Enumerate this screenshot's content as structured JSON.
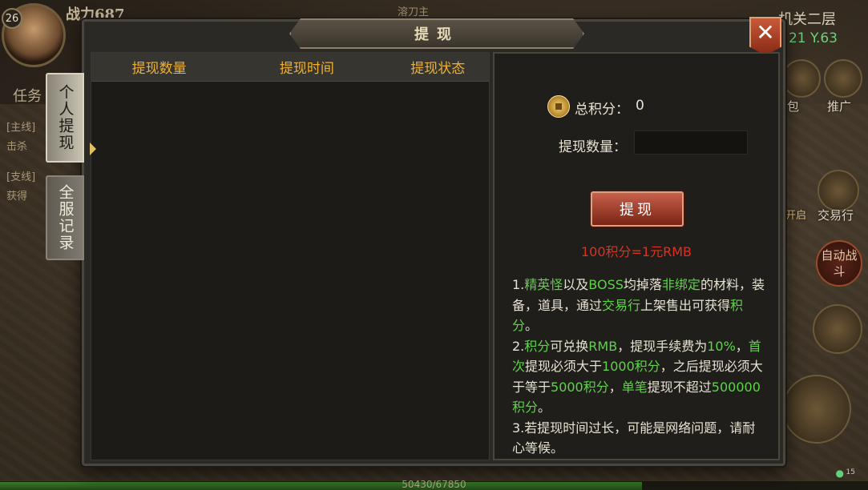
{
  "hud": {
    "level": "26",
    "power": "战力687",
    "map_top": "溶刀主",
    "map_name": "机关二层",
    "coords": "21 Y.63",
    "task_tab": "任务",
    "task_main": "[主线]",
    "task_main_detail": "击杀",
    "task_side": "[支线]",
    "task_side_detail": "获得",
    "bag_label": "包",
    "promo_label": "推广",
    "trade_label": "交易行",
    "open_label": "开启",
    "auto_fight": "自动战斗",
    "hp_text": "50430/67850",
    "wifi_num": "15"
  },
  "dialog": {
    "title": "提现",
    "close_icon": "close-icon",
    "tabs": [
      {
        "label": "个人提现",
        "active": true
      },
      {
        "label": "全服记录",
        "active": false
      }
    ],
    "list": {
      "columns": [
        "提现数量",
        "提现时间",
        "提现状态"
      ],
      "rows": []
    },
    "panel": {
      "total_label": "总积分：",
      "total_value": "0",
      "amount_label": "提现数量：",
      "amount_value": "",
      "withdraw_button": "提现",
      "rate": "100积分=1元RMB",
      "rules": [
        {
          "t": "1.",
          "c": ""
        },
        {
          "t": "精英怪",
          "c": "g"
        },
        {
          "t": "以及",
          "c": ""
        },
        {
          "t": "BOSS",
          "c": "g"
        },
        {
          "t": "均掉落",
          "c": ""
        },
        {
          "t": "非绑定",
          "c": "g"
        },
        {
          "t": "的材料，装备，道具，通过",
          "c": ""
        },
        {
          "t": "交易行",
          "c": "g"
        },
        {
          "t": "上架售出可获得",
          "c": ""
        },
        {
          "t": "积分",
          "c": "g"
        },
        {
          "t": "。",
          "c": ""
        },
        {
          "t": "\n2.",
          "c": ""
        },
        {
          "t": "积分",
          "c": "g"
        },
        {
          "t": "可兑换",
          "c": ""
        },
        {
          "t": "RMB",
          "c": "g"
        },
        {
          "t": "，提现手续费为",
          "c": ""
        },
        {
          "t": "10%",
          "c": "g"
        },
        {
          "t": "，",
          "c": ""
        },
        {
          "t": "首次",
          "c": "g"
        },
        {
          "t": "提现必须大于",
          "c": ""
        },
        {
          "t": "1000积分",
          "c": "g"
        },
        {
          "t": "，之后提现必须大于等于",
          "c": ""
        },
        {
          "t": "5000积分",
          "c": "g"
        },
        {
          "t": "，",
          "c": ""
        },
        {
          "t": "单笔",
          "c": "g"
        },
        {
          "t": "提现不超过",
          "c": ""
        },
        {
          "t": "500000积分",
          "c": "g"
        },
        {
          "t": "。",
          "c": ""
        },
        {
          "t": "\n3.若提现时间过长，可能是网络问题，请耐心等候。",
          "c": ""
        }
      ]
    }
  },
  "colors": {
    "accent_header": "#f0b030",
    "highlight_green": "#5fd24a",
    "rate_red": "#e03020",
    "button_red": "#c6604a"
  }
}
